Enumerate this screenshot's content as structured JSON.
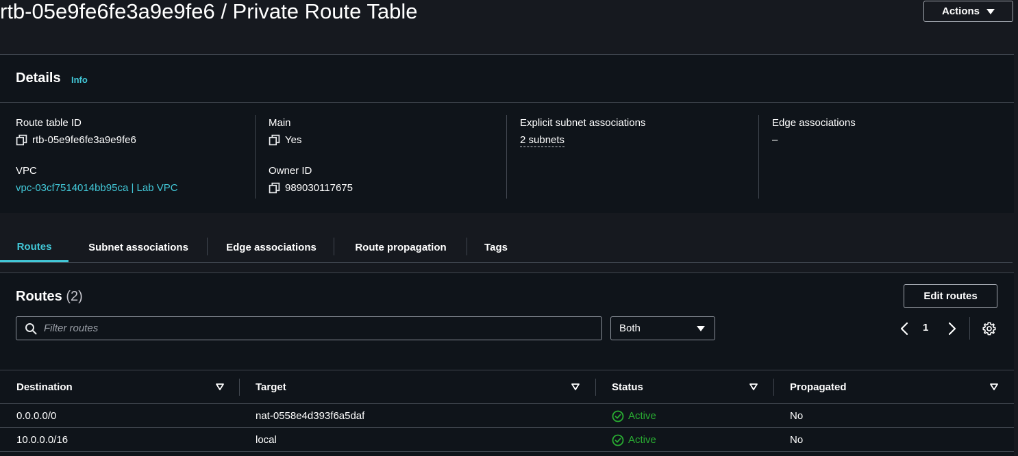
{
  "page": {
    "title": "rtb-05e9fe6fe3a9e9fe6 / Private Route Table",
    "actions_label": "Actions"
  },
  "details": {
    "title": "Details",
    "info_label": "Info",
    "route_table_id_label": "Route table ID",
    "route_table_id": "rtb-05e9fe6fe3a9e9fe6",
    "vpc_label": "VPC",
    "vpc_value": "vpc-03cf7514014bb95ca | Lab VPC",
    "main_label": "Main",
    "main_value": "Yes",
    "owner_id_label": "Owner ID",
    "owner_id": "989030117675",
    "explicit_subnet_label": "Explicit subnet associations",
    "explicit_subnet_value": "2 subnets",
    "edge_assoc_label": "Edge associations",
    "edge_assoc_value": "–"
  },
  "tabs": [
    {
      "label": "Routes",
      "active": true
    },
    {
      "label": "Subnet associations",
      "active": false
    },
    {
      "label": "Edge associations",
      "active": false
    },
    {
      "label": "Route propagation",
      "active": false
    },
    {
      "label": "Tags",
      "active": false
    }
  ],
  "routes": {
    "title": "Routes",
    "count": "(2)",
    "edit_label": "Edit routes",
    "filter_placeholder": "Filter routes",
    "filter_select_value": "Both",
    "page_number": "1",
    "columns": [
      "Destination",
      "Target",
      "Status",
      "Propagated"
    ],
    "rows": [
      {
        "destination": "0.0.0.0/0",
        "target": "nat-0558e4d393f6a5daf",
        "status": "Active",
        "propagated": "No"
      },
      {
        "destination": "10.0.0.0/16",
        "target": "local",
        "status": "Active",
        "propagated": "No"
      }
    ]
  },
  "colors": {
    "background": "#16191f",
    "panel": "#0f141a",
    "link": "#42c8d8",
    "success": "#29ad32",
    "border": "#414750"
  }
}
